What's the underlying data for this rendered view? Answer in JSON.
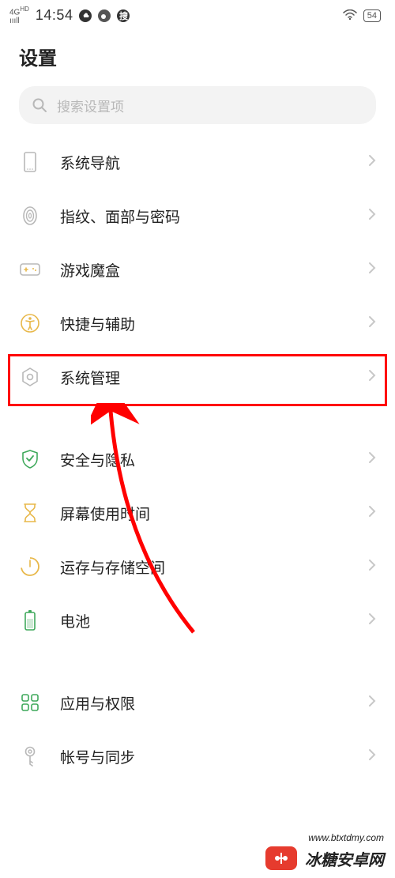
{
  "status": {
    "network": "4G",
    "network_sup": "HD",
    "time": "14:54",
    "battery": "54"
  },
  "page": {
    "title": "设置",
    "search_placeholder": "搜索设置项"
  },
  "items": [
    {
      "label": "系统导航"
    },
    {
      "label": "指纹、面部与密码"
    },
    {
      "label": "游戏魔盒"
    },
    {
      "label": "快捷与辅助"
    },
    {
      "label": "系统管理"
    },
    {
      "label": "安全与隐私"
    },
    {
      "label": "屏幕使用时间"
    },
    {
      "label": "运存与存储空间"
    },
    {
      "label": "电池"
    },
    {
      "label": "应用与权限"
    },
    {
      "label": "帐号与同步"
    }
  ],
  "watermark": {
    "text": "冰糖安卓网",
    "url": "www.btxtdmy.com"
  }
}
